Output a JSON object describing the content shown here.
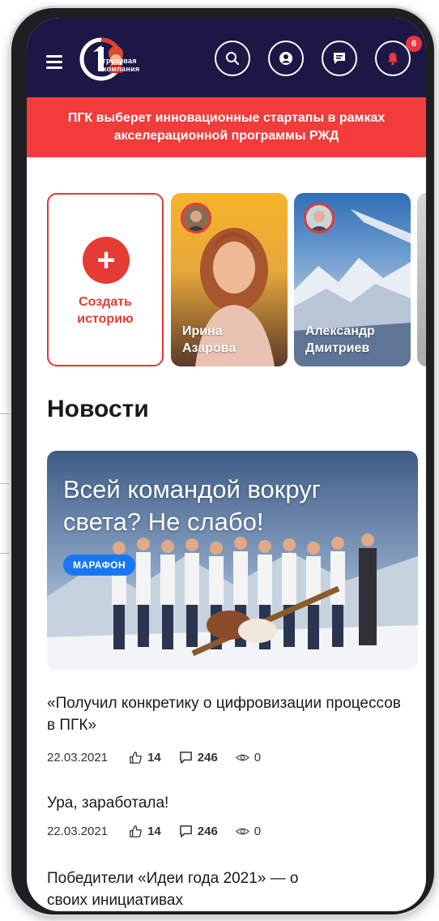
{
  "header": {
    "logo_text_line1": "грузовая",
    "logo_text_line2": "компания",
    "notification_count": "6"
  },
  "banner": {
    "text": "ПГК выберет инновационные стартапы в рамках акселерационной программы РЖД"
  },
  "stories": {
    "create_label_line1": "Создать",
    "create_label_line2": "историю",
    "items": [
      {
        "first": "Ирина",
        "last": "Азарова"
      },
      {
        "first": "Александр",
        "last": "Дмитриев"
      }
    ]
  },
  "news": {
    "section_title": "Новости",
    "featured": {
      "title": "Всей командой вокруг света? Не слабо!",
      "tag": "МАРАФОН"
    },
    "articles": [
      {
        "title": "«Получил конкретику о цифровизации процессов в ПГК»",
        "date": "22.03.2021",
        "likes": "14",
        "comments": "246",
        "views": "0"
      },
      {
        "title": "Ура, заработала!",
        "date": "22.03.2021",
        "likes": "14",
        "comments": "246",
        "views": "0"
      },
      {
        "title": "Победители «Идеи года 2021» — о своих инициативах"
      }
    ]
  },
  "colors": {
    "header_bg": "#1b1846",
    "accent_red": "#f23b3b",
    "tag_blue": "#1877f2"
  },
  "icons": [
    "menu-icon",
    "search-icon",
    "profile-icon",
    "chat-icon",
    "bell-icon",
    "plus-icon",
    "like-icon",
    "comment-icon",
    "views-icon"
  ]
}
